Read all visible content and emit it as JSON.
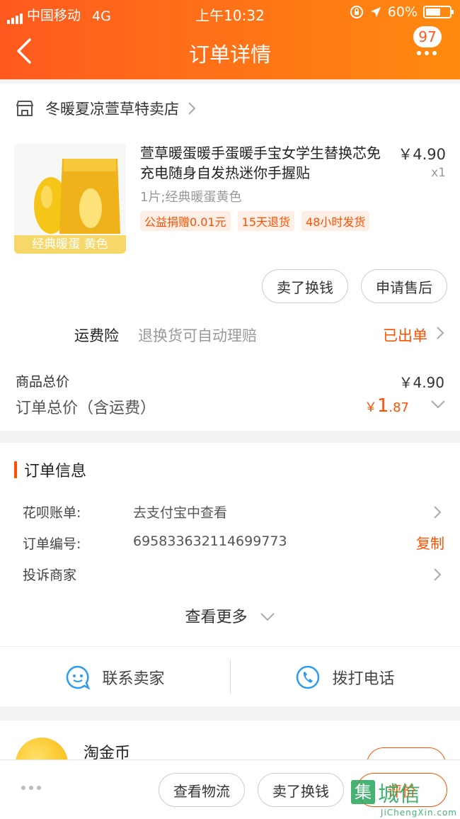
{
  "status_bar": {
    "carrier": "中国移动",
    "network": "4G",
    "time": "上午10:32",
    "battery": "60%"
  },
  "nav": {
    "title": "订单详情",
    "badge_count": "97"
  },
  "shop": {
    "name": "冬暖夏凉萱草特卖店"
  },
  "product": {
    "title": "萱草暖蛋暖手蛋暖手宝女学生替换芯免充电随身自发热迷你手握贴",
    "price": "￥4.90",
    "quantity": "x1",
    "sku": "1片;经典暖蛋黄色",
    "thumb_label": "经典暖蛋  黄色",
    "tags": [
      "公益捐赠0.01元",
      "15天退货",
      "48小时发货"
    ],
    "actions": [
      "卖了换钱",
      "申请售后"
    ]
  },
  "insurance": {
    "label": "运费险",
    "description": "退换货可自动理赔",
    "status": "已出单"
  },
  "summary": {
    "goods_total_label": "商品总价",
    "goods_total_value": "￥4.90",
    "order_total_label": "订单总价（含运费）",
    "order_total_currency": "￥",
    "order_total_int": "1",
    "order_total_dec": ".87"
  },
  "order_info": {
    "title": "订单信息",
    "rows": [
      {
        "key": "花呗账单:",
        "value": "去支付宝中查看"
      },
      {
        "key": "订单编号:",
        "value": "695833632114699773",
        "action": "复制"
      },
      {
        "key": "投诉商家",
        "value": ""
      }
    ],
    "see_more": "查看更多"
  },
  "contact": {
    "seller": "联系卖家",
    "phone": "拨打电话"
  },
  "coins": {
    "title": "淘金币"
  },
  "bottom_bar": {
    "buttons": [
      "查看物流",
      "卖了换钱",
      "评价"
    ]
  },
  "watermark": {
    "cn": "城信",
    "square": "集",
    "en": "JiChengXin.com"
  },
  "colors": {
    "accent": "#ff5000",
    "header_start": "#ff5a1f",
    "header_end": "#ff8a0f"
  }
}
